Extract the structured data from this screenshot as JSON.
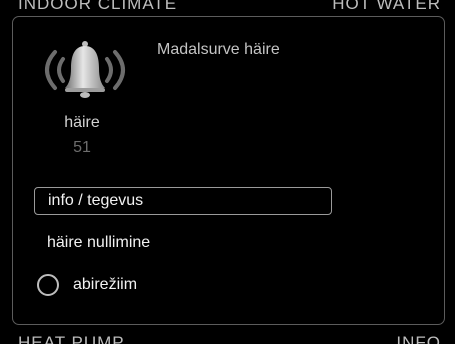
{
  "background": {
    "top_left": "INDOOR CLIMATE",
    "top_right": "HOT WATER",
    "bottom_left": "HEAT PUMP",
    "bottom_right": "INFO"
  },
  "alarm": {
    "icon": "bell-icon",
    "title": "Madalsurve häire",
    "label": "häire",
    "code": "51"
  },
  "menu": {
    "info_action": "info / tegevus",
    "reset_alarm": "häire nullimine",
    "aid_mode": "abirežiim"
  },
  "colors": {
    "background": "#000000",
    "text": "#f2f2f2",
    "muted": "#6d6d6d",
    "border": "#5c5c5c"
  }
}
